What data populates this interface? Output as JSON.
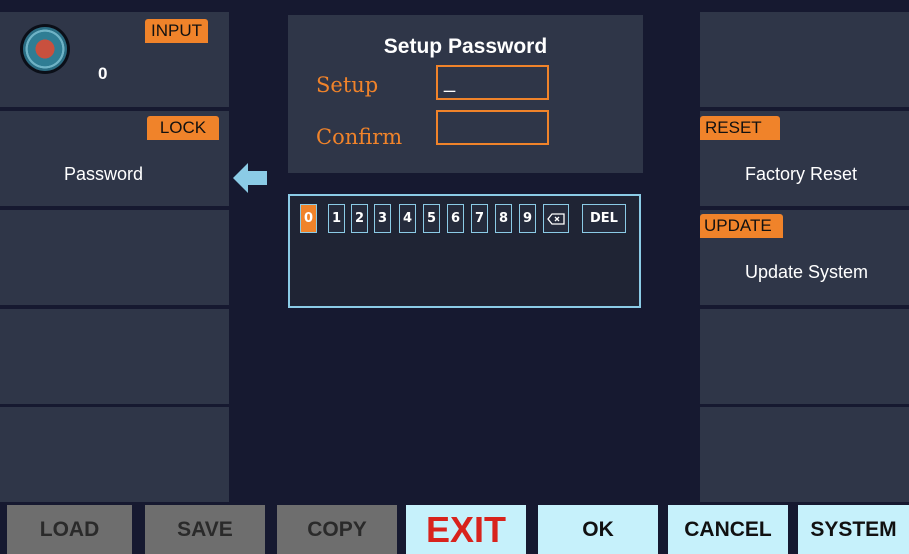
{
  "left": {
    "input_tag": "INPUT",
    "knob_value": "0",
    "lock_tag": "LOCK",
    "password_label": "Password"
  },
  "dialog": {
    "title": "Setup Password",
    "setup_label": "Setup",
    "setup_value": "_",
    "confirm_label": "Confirm",
    "confirm_value": ""
  },
  "keypad": {
    "keys": [
      "0",
      "1",
      "2",
      "3",
      "4",
      "5",
      "6",
      "7",
      "8",
      "9"
    ],
    "del_label": "DEL",
    "active_key": "0"
  },
  "right": {
    "reset_tag": "RESET",
    "factory_reset_label": "Factory Reset",
    "update_tag": "UPDATE",
    "update_system_label": "Update System"
  },
  "bottom": {
    "load": "LOAD",
    "save": "SAVE",
    "copy": "COPY",
    "exit": "EXIT",
    "ok": "OK",
    "cancel": "CANCEL",
    "system": "SYSTEM"
  },
  "colors": {
    "accent": "#f0832a",
    "exit_red": "#d8231c",
    "ok_cyan": "#c6f1fb",
    "keypad_border": "#8bcbe6",
    "disabled_button": "#6e6e6e"
  }
}
